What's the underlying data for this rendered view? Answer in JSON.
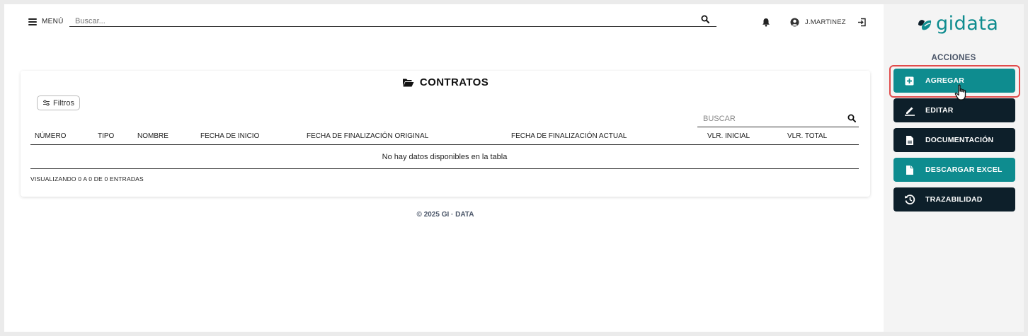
{
  "topbar": {
    "menu_label": "MENÚ",
    "search_placeholder": "Buscar...",
    "username": "J.MARTINEZ"
  },
  "card": {
    "title": "CONTRATOS",
    "filters_label": "Filtros",
    "search_placeholder": "BUSCAR",
    "columns": [
      "NÚMERO",
      "TIPO",
      "NOMBRE",
      "FECHA DE INICIO",
      "FECHA DE FINALIZACIÓN ORIGINAL",
      "FECHA DE FINALIZACIÓN ACTUAL",
      "VLR. INICIAL",
      "VLR. TOTAL"
    ],
    "empty_message": "No hay datos disponibles en la tabla",
    "info": "VISUALIZANDO 0 A 0 DE 0 ENTRADAS"
  },
  "footer": {
    "text": "© 2025 GI · DATA"
  },
  "sidebar": {
    "logo_text": "gidata",
    "section_title": "ACCIONES",
    "actions": [
      {
        "label": "AGREGAR",
        "icon": "plus-square-icon",
        "color": "#0e8c8f"
      },
      {
        "label": "EDITAR",
        "icon": "pencil-icon",
        "color": "#0d1f2a"
      },
      {
        "label": "DOCUMENTACIÓN",
        "icon": "document-icon",
        "color": "#0d1f2a"
      },
      {
        "label": "DESCARGAR EXCEL",
        "icon": "file-icon",
        "color": "#0e8c8f"
      },
      {
        "label": "TRAZABILIDAD",
        "icon": "history-icon",
        "color": "#0d1f2a"
      }
    ]
  },
  "colors": {
    "accent": "#0e8c8f",
    "dark": "#0d1f2a",
    "highlight": "#e14b4b"
  }
}
